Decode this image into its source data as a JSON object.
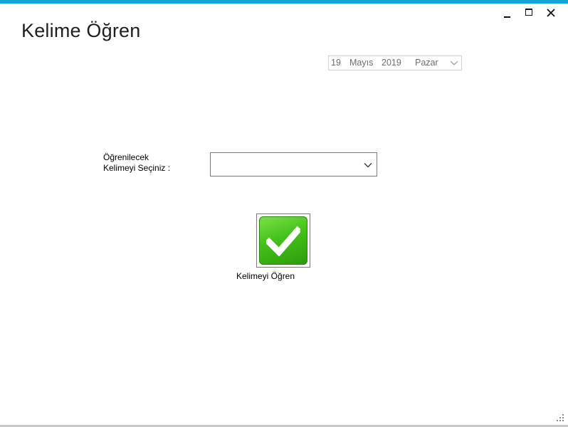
{
  "window": {
    "title": "Kelime Öğren",
    "accent_color": "#12a3d8",
    "controls": [
      "minimize-icon",
      "maximize-icon",
      "close-icon"
    ]
  },
  "datepicker": {
    "day": "19",
    "month": "Mayıs",
    "year": "2019",
    "weekday": "Pazar",
    "icon": "chevron-down-icon"
  },
  "form": {
    "label": "Öğrenilecek\nKelimeyi Seçiniz :",
    "word_select": {
      "value": "",
      "icon": "chevron-down-icon"
    }
  },
  "action": {
    "label": "Kelimeyi Öğren",
    "icon": "checkmark-icon",
    "icon_color": "#43c21a"
  }
}
